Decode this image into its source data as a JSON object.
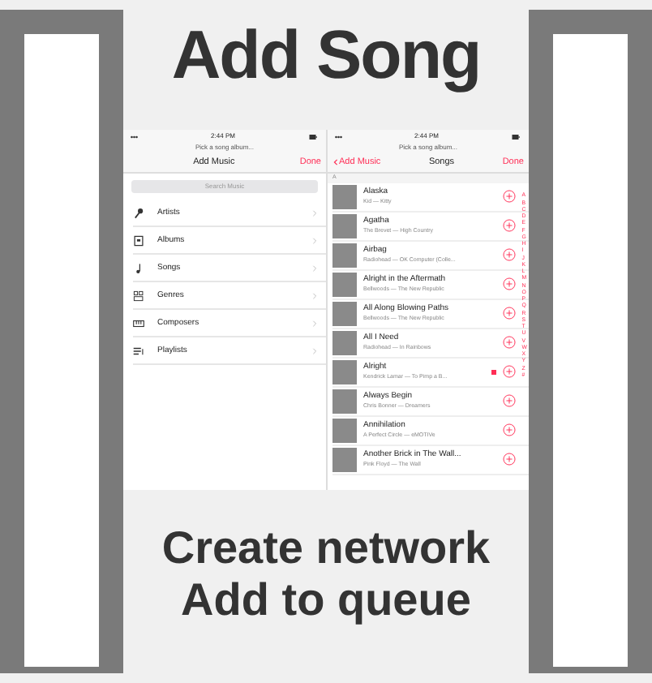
{
  "title": "Add Song",
  "left_screen": {
    "status_time": "2:44 PM",
    "prompt": "Pick a song album...",
    "nav_title": "Add Music",
    "done": "Done",
    "search_placeholder": "Search Music",
    "items": [
      {
        "label": "Artists",
        "kind": "microphone"
      },
      {
        "label": "Albums",
        "kind": "album"
      },
      {
        "label": "Songs",
        "kind": "note"
      },
      {
        "label": "Genres",
        "kind": "genre"
      },
      {
        "label": "Composers",
        "kind": "piano"
      },
      {
        "label": "Playlists",
        "kind": "playlist"
      }
    ]
  },
  "right_screen": {
    "status_time": "2:44 PM",
    "prompt": "Pick a song album...",
    "back": "Add Music",
    "nav_title": "Songs",
    "done": "Done",
    "section": "A",
    "songs": [
      {
        "title": "Alaska",
        "subtitle": "Kid — Kitty",
        "flagged": false
      },
      {
        "title": "Agatha",
        "subtitle": "The Brevet — High Country",
        "flagged": false
      },
      {
        "title": "Airbag",
        "subtitle": "Radiohead — OK Computer (Colle...",
        "flagged": false
      },
      {
        "title": "Alright in the Aftermath",
        "subtitle": "Bellwoods — The New Republic",
        "flagged": false
      },
      {
        "title": "All Along Blowing Paths",
        "subtitle": "Bellwoods — The New Republic",
        "flagged": false
      },
      {
        "title": "All I Need",
        "subtitle": "Radiohead — In Rainbows",
        "flagged": false
      },
      {
        "title": "Alright",
        "subtitle": "Kendrick Lamar — To Pimp a B...",
        "flagged": true
      },
      {
        "title": "Always Begin",
        "subtitle": "Chris Bonner — Dreamers",
        "flagged": false
      },
      {
        "title": "Annihilation",
        "subtitle": "A Perfect Circle — eMOTIVe",
        "flagged": false
      },
      {
        "title": "Another Brick in The Wall...",
        "subtitle": "Pink Floyd — The Wall",
        "flagged": false
      }
    ],
    "index": [
      "A",
      "B",
      "C",
      "D",
      "E",
      "F",
      "G",
      "H",
      "I",
      "J",
      "K",
      "L",
      "M",
      "N",
      "O",
      "P",
      "Q",
      "R",
      "S",
      "T",
      "U",
      "V",
      "W",
      "X",
      "Y",
      "Z",
      "#"
    ]
  },
  "caption": [
    "Create network",
    "Add to queue"
  ]
}
